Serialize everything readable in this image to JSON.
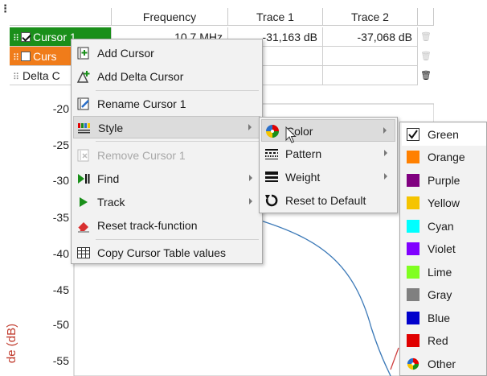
{
  "table": {
    "headers": [
      "Frequency",
      "Trace 1",
      "Trace 2"
    ],
    "rows": [
      {
        "name": "Cursor 1",
        "frequency": "10.7 MHz",
        "trace1": "-31,163 dB",
        "trace2": "-37,068 dB",
        "color": "#1a8f1a"
      },
      {
        "name": "Curs",
        "frequency": "",
        "trace1": "",
        "trace2": "",
        "color": "#f07c1a"
      },
      {
        "name": "Delta C",
        "frequency": "",
        "trace1": "",
        "trace2": "",
        "color": "#ffffff"
      }
    ]
  },
  "chart": {
    "y_ticks": [
      "-20",
      "-25",
      "-30",
      "-35",
      "-40",
      "-45",
      "-50",
      "-55"
    ],
    "y_title": "de (dB)",
    "line_color": "#3d7ab8"
  },
  "context_menu": {
    "items": [
      {
        "label": "Add Cursor",
        "icon": "add-cursor-icon"
      },
      {
        "label": "Add Delta Cursor",
        "icon": "add-delta-cursor-icon"
      },
      {
        "label": "Rename Cursor 1",
        "icon": "rename-icon"
      },
      {
        "label": "Style",
        "icon": "style-icon"
      },
      {
        "label": "Remove Cursor 1",
        "icon": "remove-icon"
      },
      {
        "label": "Find",
        "icon": "find-icon"
      },
      {
        "label": "Track",
        "icon": "track-icon"
      },
      {
        "label": "Reset track-function",
        "icon": "eraser-icon"
      },
      {
        "label": "Copy Cursor Table values",
        "icon": "table-icon"
      }
    ]
  },
  "style_menu": {
    "items": [
      {
        "label": "Color",
        "icon": "color-wheel-icon"
      },
      {
        "label": "Pattern",
        "icon": "pattern-icon"
      },
      {
        "label": "Weight",
        "icon": "weight-icon"
      },
      {
        "label": "Reset to Default",
        "icon": "reset-icon"
      }
    ]
  },
  "color_menu": {
    "items": [
      {
        "label": "Green",
        "color": "#ffffff",
        "checked": true
      },
      {
        "label": "Orange",
        "color": "#ff8000"
      },
      {
        "label": "Purple",
        "color": "#800080"
      },
      {
        "label": "Yellow",
        "color": "#f5c400"
      },
      {
        "label": "Cyan",
        "color": "#00ffff"
      },
      {
        "label": "Violet",
        "color": "#8000ff"
      },
      {
        "label": "Lime",
        "color": "#80ff20"
      },
      {
        "label": "Gray",
        "color": "#808080"
      },
      {
        "label": "Blue",
        "color": "#0000cc"
      },
      {
        "label": "Red",
        "color": "#e00000"
      },
      {
        "label": "Other",
        "color": "multicolor"
      }
    ]
  }
}
